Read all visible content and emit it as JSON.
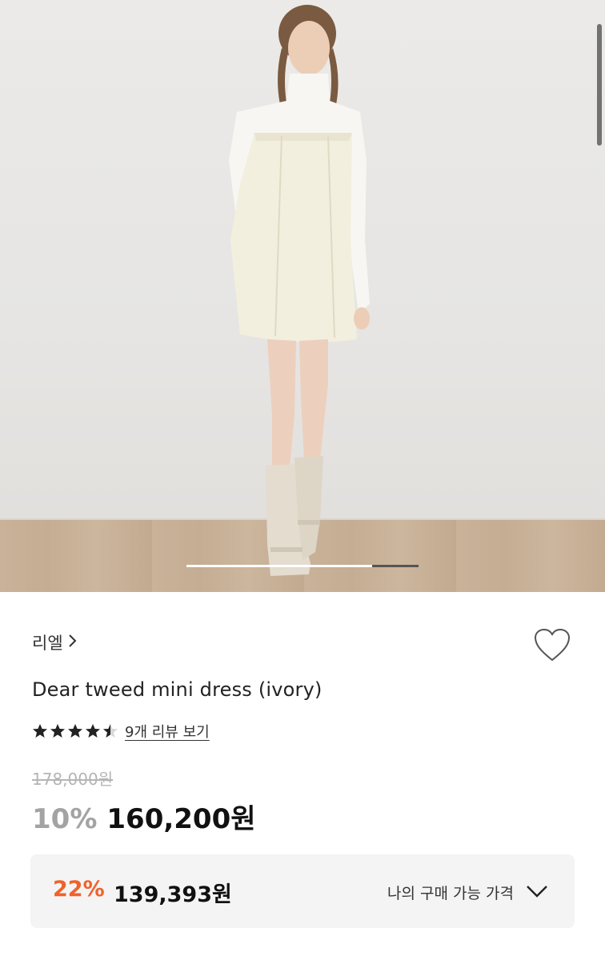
{
  "product": {
    "brand": "리엘",
    "name": "Dear tweed mini dress (ivory)",
    "rating": 4.5,
    "review_link": "9개 리뷰 보기",
    "original_price": "178,000원",
    "discount_rate": "10%",
    "sale_price": "160,200원"
  },
  "my_price": {
    "discount_rate": "22%",
    "price": "139,393원",
    "label": "나의 구매 가능 가격"
  },
  "gallery": {
    "progress_fraction": 0.8
  },
  "colors": {
    "accent_orange": "#f0622a",
    "muted_gray": "#a3a3a3",
    "box_bg": "#f4f4f4"
  },
  "icons": [
    "chevron-right-icon",
    "heart-icon",
    "star-icon",
    "chevron-down-icon"
  ]
}
